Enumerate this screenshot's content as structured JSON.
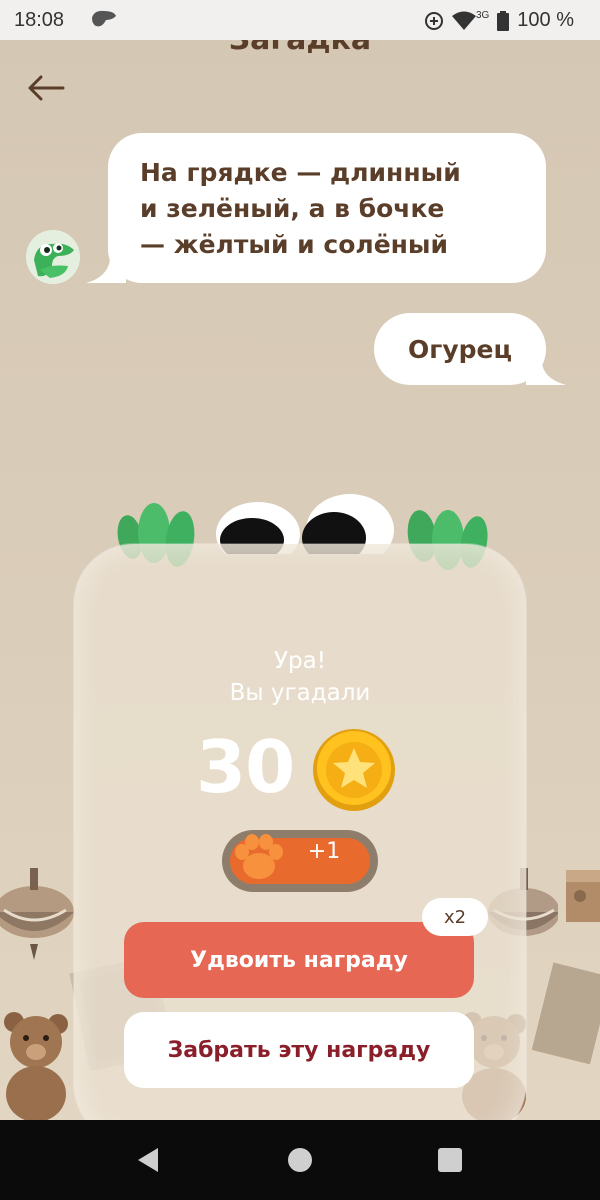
{
  "status_bar": {
    "time": "18:08",
    "network": "3G",
    "battery": "100 %"
  },
  "header": {
    "title": "Загадка",
    "back_icon": "arrow-left-icon"
  },
  "chat": {
    "riddle_lines": [
      "На грядке — длинный",
      "и зелёный, а в бочке",
      "— жёлтый и солёный"
    ],
    "answer": "Огурец"
  },
  "result": {
    "title_line1": "Ура!",
    "title_line2": "Вы угадали",
    "score": "30",
    "coin_icon": "star-coin-icon",
    "paw_bonus": "+1",
    "double_badge": "x2",
    "double_button": "Удвоить награду",
    "take_button": "Забрать эту награду"
  },
  "colors": {
    "accent": "#e56754",
    "text_brown": "#5a3e2a",
    "paw_orange": "#e86a2d",
    "take_text": "#8a1f2a"
  }
}
